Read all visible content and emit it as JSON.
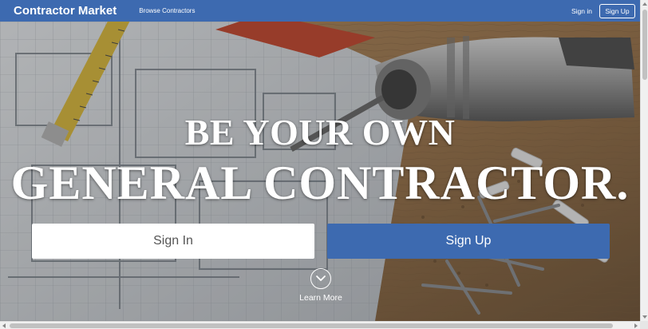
{
  "navbar": {
    "brand": "Contractor Market",
    "browse_link": "Browse Contractors",
    "signin_link": "Sign in",
    "signup_button": "Sign Up",
    "color": "#3d6ab0"
  },
  "hero": {
    "headline_line1": "BE YOUR OWN",
    "headline_line2": "GENERAL CONTRACTOR.",
    "signin_button": "Sign In",
    "signup_button": "Sign Up",
    "learn_more": "Learn More",
    "learn_more_icon": "chevron-down-circle-icon",
    "background_image": "blueprints-drill-tape-measure-photo"
  }
}
